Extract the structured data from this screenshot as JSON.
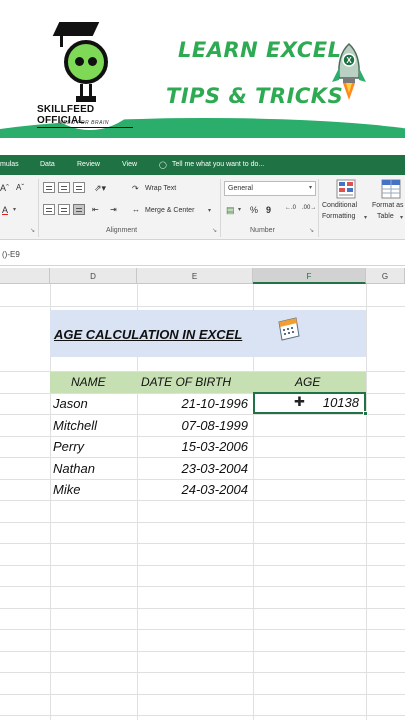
{
  "banner": {
    "brand_name": "SKILLFEED OFFICIAL",
    "brand_tagline": "FEED FOR BRAIN",
    "headline_line1": "LEARN EXCEL",
    "headline_line2": "TIPS & TRICKS",
    "rocket_icon": "excel-rocket-icon",
    "accent_color": "#2bae6b"
  },
  "ribbon": {
    "tabs": [
      {
        "label": "mulas"
      },
      {
        "label": "Data"
      },
      {
        "label": "Review"
      },
      {
        "label": "View"
      }
    ],
    "tell_me": "Tell me what you want to do...",
    "wrap_text": "Wrap Text",
    "merge_center": "Merge & Center",
    "number_format": "General",
    "percent": "%",
    "comma": "9",
    "conditional_formatting_1": "Conditional",
    "conditional_formatting_2": "Formatting",
    "format_as_table_1": "Format as",
    "format_as_table_2": "Table",
    "alignment_group": "Alignment",
    "number_group": "Number",
    "color": "#1f7244"
  },
  "formula_bar": {
    "content": "()-E9"
  },
  "columns": [
    "D",
    "E",
    "F",
    "G"
  ],
  "sheet": {
    "title": "AGE CALCULATION IN EXCEL",
    "headers": {
      "name": "NAME",
      "dob": "DATE OF BIRTH",
      "age": "AGE"
    },
    "rows": [
      {
        "name": "Jason",
        "dob": "21-10-1996",
        "age": "10138"
      },
      {
        "name": "Mitchell",
        "dob": "07-08-1999",
        "age": ""
      },
      {
        "name": "Perry",
        "dob": "15-03-2006",
        "age": ""
      },
      {
        "name": "Nathan",
        "dob": "23-03-2004",
        "age": ""
      },
      {
        "name": "Mike",
        "dob": "24-03-2004",
        "age": ""
      }
    ],
    "title_band_color": "#dae3f3",
    "header_band_color": "#c6e0b4"
  }
}
